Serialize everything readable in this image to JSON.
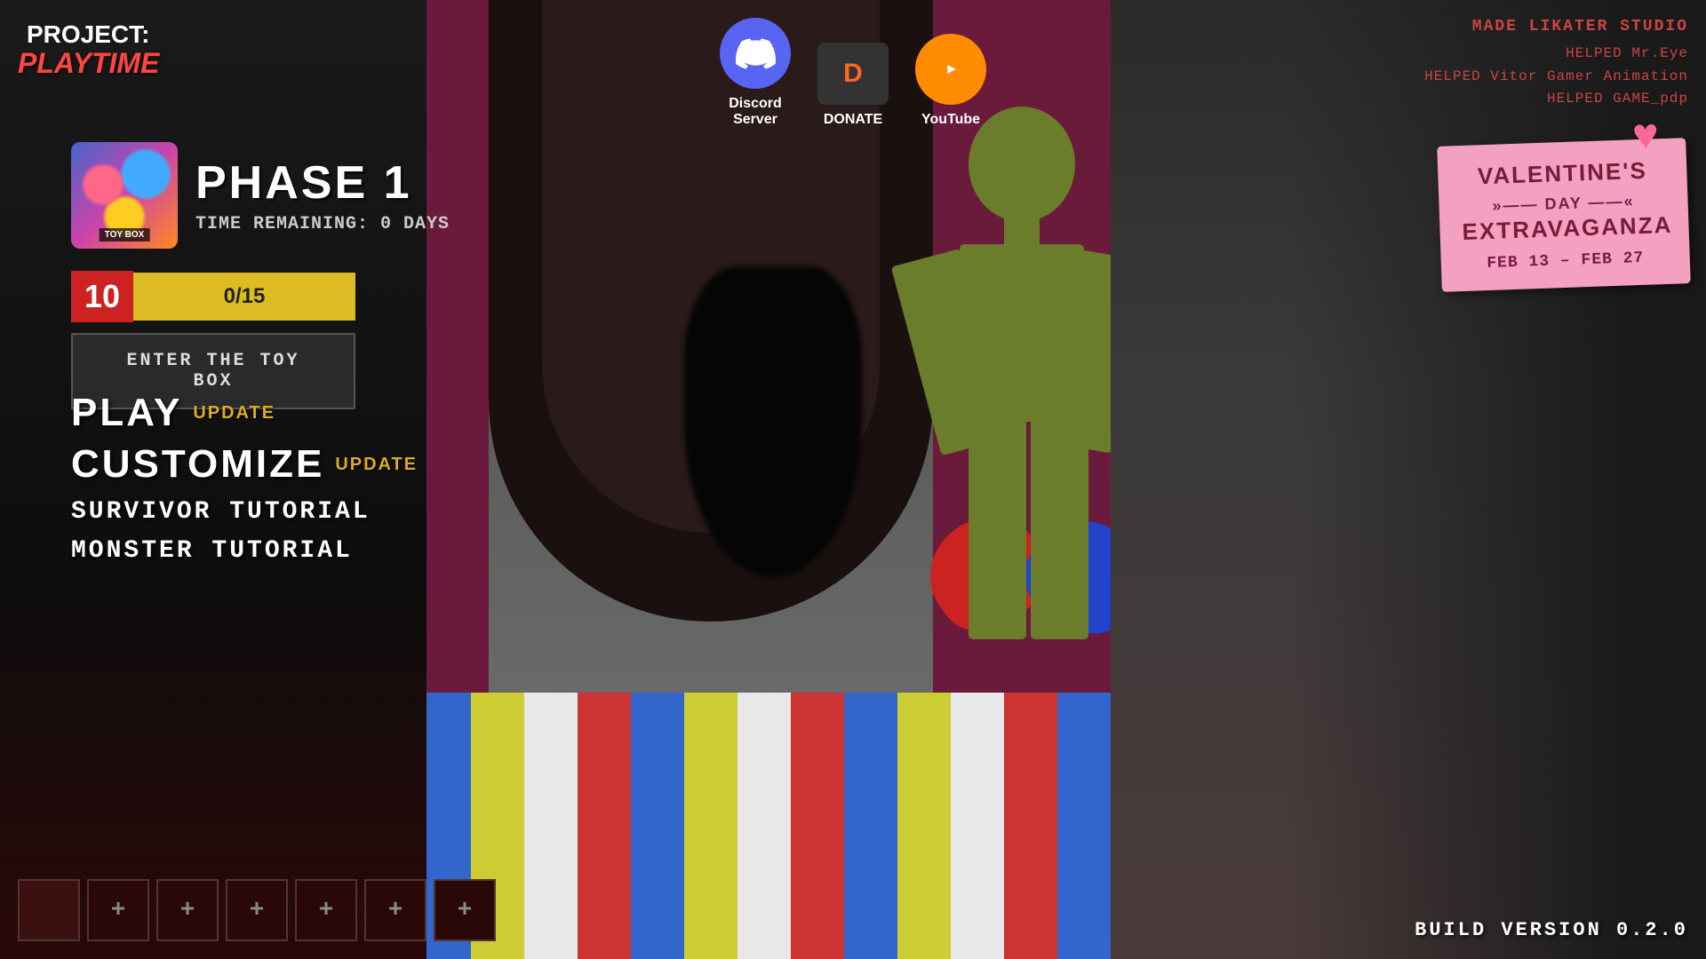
{
  "logo": {
    "project_label": "PROJECT:",
    "playtime_label": "PLAYTIME"
  },
  "social": {
    "discord_label": "Discord\nServer",
    "donate_label": "DONATE",
    "youtube_label": "YouTube"
  },
  "credits": {
    "studio": "MADE LIKATER STUDIO",
    "helped": [
      "HELPED Mr.Eye",
      "HELPED Vitor Gamer Animation",
      "HELPED GAME_pdp"
    ]
  },
  "phase": {
    "title": "PHASE 1",
    "time_remaining": "TIME REMAINING: 0 DAYS",
    "toy_box_label": "TOY\nBOX",
    "progress_num": "10",
    "progress_current": "0",
    "progress_total": "15",
    "progress_display": "0/15"
  },
  "enter_button": {
    "label": "ENTER THE TOY BOX"
  },
  "menu": {
    "play_label": "PLAY",
    "play_badge": "UPDATE",
    "customize_label": "CUSTOMIZE",
    "customize_badge": "UPDATE",
    "survivor_label": "SURVIVOR TUTORIAL",
    "monster_label": "MONSTER TUTORIAL"
  },
  "inventory": {
    "slots": [
      {
        "filled": true,
        "label": ""
      },
      {
        "filled": false,
        "label": "+"
      },
      {
        "filled": false,
        "label": "+"
      },
      {
        "filled": false,
        "label": "+"
      },
      {
        "filled": false,
        "label": "+"
      },
      {
        "filled": false,
        "label": "+"
      },
      {
        "filled": false,
        "label": "+"
      }
    ]
  },
  "valentine": {
    "title": "VALENTINE'S DAY EXTRAVAGANZA",
    "dash_line": "»—— DAY ——«",
    "date_range": "FEB 13 – FEB 27"
  },
  "build": {
    "version": "BUILD VERSION 0.2.0"
  }
}
